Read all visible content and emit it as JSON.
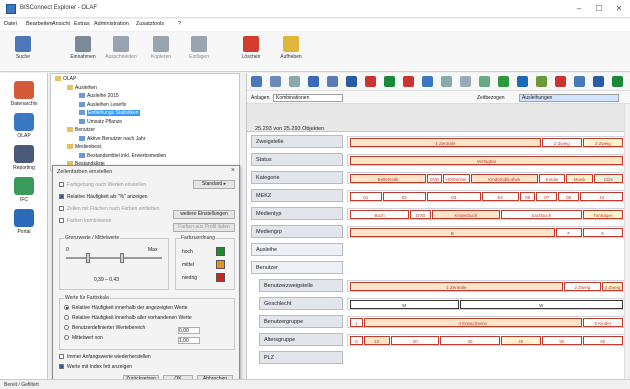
{
  "window": {
    "title": "BISConnect Explorer - OLAF",
    "controls": [
      "–",
      "☐",
      "✕"
    ]
  },
  "menu": [
    "Datei",
    "Bearbeiten",
    "Ansicht",
    "Extras",
    "Administration",
    "Zusatztools",
    "?"
  ],
  "ribbon": [
    {
      "label": "Suche",
      "icon": "search-icon",
      "disabled": false
    },
    {
      "label": "Einnahmen",
      "icon": "satellite-icon",
      "disabled": false
    },
    {
      "label": "Ausschneiden",
      "icon": "scissors-icon",
      "disabled": true
    },
    {
      "label": "Kopieren",
      "icon": "copy-icon",
      "disabled": true
    },
    {
      "label": "Einfügen",
      "icon": "paste-icon",
      "disabled": true
    },
    {
      "label": "Löschen",
      "icon": "delete-icon",
      "disabled": false
    },
    {
      "label": "Aufheben",
      "icon": "folder-icon",
      "disabled": false
    }
  ],
  "sidebar": [
    {
      "label": "Datenarchiv",
      "icon": "archive-icon"
    },
    {
      "label": "OLAP",
      "icon": "olap-icon"
    },
    {
      "label": "Reporting",
      "icon": "report-icon"
    },
    {
      "label": "IFC",
      "icon": "ifc-icon"
    },
    {
      "label": "Portal",
      "icon": "portal-icon"
    }
  ],
  "tree": [
    {
      "label": "OLAP",
      "level": 0,
      "selected": false
    },
    {
      "label": "Ausleihen",
      "level": 1,
      "selected": false
    },
    {
      "label": "Ausleihe 2015",
      "level": 2,
      "selected": false
    },
    {
      "label": "Ausleihen Lesefix",
      "level": 2,
      "selected": false
    },
    {
      "label": "Entleihungs Statistiken",
      "level": 2,
      "selected": true
    },
    {
      "label": "Umsatz Pflanze",
      "level": 2,
      "selected": false
    },
    {
      "label": "Benutzer",
      "level": 1,
      "selected": false
    },
    {
      "label": "Aktive Benutzer nach Jahr",
      "level": 2,
      "selected": false
    },
    {
      "label": "Medienbest.",
      "level": 1,
      "selected": false
    },
    {
      "label": "Bestandsmittel inkl. Erwerbsmedien",
      "level": 2,
      "selected": false
    },
    {
      "label": "Bestandsliste",
      "level": 1,
      "selected": false
    }
  ],
  "dialog": {
    "title": "Zellenfarben einstellen",
    "close": "×",
    "options": [
      {
        "label": "Farbgebung nach Werten einstellen",
        "checked": false,
        "disabled": true
      },
      {
        "label": "Relative Häufigkeit als \"%\" anzeigen",
        "checked": true,
        "disabled": false
      },
      {
        "label": "Zellen mit Flächen nach Farben einfärben",
        "checked": false,
        "disabled": true
      },
      {
        "label": "Farben kombinieren",
        "checked": false,
        "disabled": true
      }
    ],
    "btn_standard": "Standard ▸",
    "btn_weitere": "weitere Einstellungen",
    "btn_farben": "Farben aus Profil laden",
    "group_range": "Grenzwerte / Mittelwerte",
    "range_low": "0",
    "range_high": "Max",
    "range_value": "0,39 – 0,43",
    "group_colors": "Farbzuordnung",
    "color_rows": [
      {
        "label": "hoch",
        "color": "#1f8a2e"
      },
      {
        "label": "mittel",
        "color": "#e8901a"
      },
      {
        "label": "niedrig",
        "color": "#c62828"
      }
    ],
    "group_filter": "Werte für Farbskala",
    "filter_options": [
      {
        "label": "Relative Häufigkeit innerhalb der angezeigten Werte",
        "checked": true
      },
      {
        "label": "Relative Häufigkeit innerhalb aller vorhandenen Werte",
        "checked": false
      },
      {
        "label": "Benutzerdefinierter Wertebereich",
        "checked": false
      },
      {
        "label": "Mittelwert von",
        "checked": false
      }
    ],
    "min_value": "0,00",
    "max_value": "1,00",
    "bottom_checks": [
      {
        "label": "Immer Anfangswerte wiederherstellen",
        "checked": false
      },
      {
        "label": "Werte mit Index fett anzeigen",
        "checked": true
      }
    ],
    "btn_reset": "Zurücksetzen",
    "btn_ok": "OK",
    "btn_cancel": "Abbrechen"
  },
  "main": {
    "filter_label": "Anlagen",
    "filter_value": "Kombinationen",
    "filter_label2": "Zeitbezogen",
    "filter_value2": "Ausleihungen",
    "count_text": "25.293 von 25.293 Objekten",
    "rows": [
      {
        "label": "Zweigstelle",
        "indent": false,
        "group": false,
        "segs": [
          {
            "t": "1 Zentrale",
            "w": 0.7,
            "c": "#fde6c8",
            "fc": "#c0392b"
          },
          {
            "t": "2 Zweig",
            "w": 0.15,
            "c": "#fff",
            "fc": "#c0392b"
          },
          {
            "t": "3 Zweig",
            "w": 0.15,
            "c": "#fff6d0",
            "fc": "#c0392b"
          }
        ]
      },
      {
        "label": "Status",
        "indent": false,
        "group": false,
        "segs": [
          {
            "t": "Verfügbar",
            "w": 1.0,
            "c": "#fde6c8",
            "fc": "#c0392b"
          }
        ]
      },
      {
        "label": "Kategorie",
        "indent": false,
        "group": false,
        "segs": [
          {
            "t": "Belletristik",
            "w": 0.28,
            "c": "#fde6c8",
            "fc": "#c0392b"
          },
          {
            "t": "DVD",
            "w": 0.06,
            "c": "#fff",
            "fc": "#c0392b"
          },
          {
            "t": "Hörbücher",
            "w": 0.1,
            "c": "#fff",
            "fc": "#c0392b"
          },
          {
            "t": "Kinderbibliothek",
            "w": 0.25,
            "c": "#fde6c8",
            "fc": "#c0392b"
          },
          {
            "t": "Kinder",
            "w": 0.1,
            "c": "#fff",
            "fc": "#c0392b"
          },
          {
            "t": "Musik",
            "w": 0.1,
            "c": "#fff6d0",
            "fc": "#c0392b"
          },
          {
            "t": "CDs",
            "w": 0.11,
            "c": "#e6f5e0",
            "fc": "#c0392b"
          }
        ]
      },
      {
        "label": "MEKZ",
        "indent": false,
        "group": false,
        "segs": [
          {
            "t": "01",
            "w": 0.12,
            "c": "#fff",
            "fc": "#c0392b"
          },
          {
            "t": "02",
            "w": 0.16,
            "c": "#fff",
            "fc": "#c0392b"
          },
          {
            "t": "03",
            "w": 0.2,
            "c": "#fff",
            "fc": "#c0392b"
          },
          {
            "t": "04",
            "w": 0.14,
            "c": "#fff",
            "fc": "#c0392b"
          },
          {
            "t": "05",
            "w": 0.06,
            "c": "#fff",
            "fc": "#c0392b"
          },
          {
            "t": "07",
            "w": 0.08,
            "c": "#fff",
            "fc": "#c0392b"
          },
          {
            "t": "08",
            "w": 0.08,
            "c": "#fff",
            "fc": "#c0392b"
          },
          {
            "t": "10",
            "w": 0.16,
            "c": "#fff",
            "fc": "#c0392b"
          }
        ]
      },
      {
        "label": "Medientyp",
        "indent": false,
        "group": false,
        "segs": [
          {
            "t": "Buch",
            "w": 0.22,
            "c": "#fff",
            "fc": "#c0392b"
          },
          {
            "t": "DVD",
            "w": 0.08,
            "c": "#fff",
            "fc": "#c0392b"
          },
          {
            "t": "Kinderbuch",
            "w": 0.25,
            "c": "#fde6c8",
            "fc": "#c0392b"
          },
          {
            "t": "Sachbuch",
            "w": 0.3,
            "c": "#fff",
            "fc": "#c0392b"
          },
          {
            "t": "Tonträger",
            "w": 0.15,
            "c": "#fff6d0",
            "fc": "#c0392b"
          }
        ]
      },
      {
        "label": "Mediengrp",
        "indent": false,
        "group": false,
        "segs": [
          {
            "t": "B",
            "w": 0.75,
            "c": "#fde6c8",
            "fc": "#c0392b"
          },
          {
            "t": "F",
            "w": 0.1,
            "c": "#fff",
            "fc": "#c0392b"
          },
          {
            "t": "K",
            "w": 0.15,
            "c": "#fff",
            "fc": "#c0392b"
          }
        ]
      },
      {
        "label": "Ausleihe",
        "indent": false,
        "group": true,
        "segs": []
      },
      {
        "label": "Benutzer",
        "indent": false,
        "group": true,
        "segs": []
      },
      {
        "label": "Benutzerzweigstelle",
        "indent": true,
        "group": false,
        "segs": [
          {
            "t": "1 Zentrale",
            "w": 0.78,
            "c": "#fde6c8",
            "fc": "#c0392b"
          },
          {
            "t": "2 Zweig",
            "w": 0.14,
            "c": "#fff",
            "fc": "#c0392b"
          },
          {
            "t": "3 Zweig",
            "w": 0.08,
            "c": "#fff6d0",
            "fc": "#c0392b"
          }
        ]
      },
      {
        "label": "Geschlecht",
        "indent": true,
        "group": false,
        "segs": [
          {
            "t": "M",
            "w": 0.4,
            "c": "#fff",
            "fc": "#333"
          },
          {
            "t": "W",
            "w": 0.6,
            "c": "#fff",
            "fc": "#333"
          }
        ]
      },
      {
        "label": "Benutzergruppe",
        "indent": true,
        "group": false,
        "segs": [
          {
            "t": "1",
            "w": 0.05,
            "c": "#fff",
            "fc": "#c0392b"
          },
          {
            "t": "4 Erwachsene",
            "w": 0.8,
            "c": "#fde6c8",
            "fc": "#c0392b"
          },
          {
            "t": "5 Kinder",
            "w": 0.15,
            "c": "#fff",
            "fc": "#c0392b"
          }
        ]
      },
      {
        "label": "Altersgruppe",
        "indent": true,
        "group": false,
        "segs": [
          {
            "t": "0",
            "w": 0.05,
            "c": "#fff",
            "fc": "#c0392b"
          },
          {
            "t": "10",
            "w": 0.1,
            "c": "#fde6c8",
            "fc": "#c0392b"
          },
          {
            "t": "20",
            "w": 0.18,
            "c": "#fff",
            "fc": "#c0392b"
          },
          {
            "t": "30",
            "w": 0.22,
            "c": "#fff",
            "fc": "#c0392b"
          },
          {
            "t": "40",
            "w": 0.15,
            "c": "#fff6d0",
            "fc": "#c0392b"
          },
          {
            "t": "50",
            "w": 0.15,
            "c": "#fff",
            "fc": "#c0392b"
          },
          {
            "t": "60",
            "w": 0.15,
            "c": "#fff",
            "fc": "#c0392b"
          }
        ]
      },
      {
        "label": "PLZ",
        "indent": true,
        "group": false,
        "segs": []
      }
    ]
  },
  "status": "Bereit / Gefiltert"
}
